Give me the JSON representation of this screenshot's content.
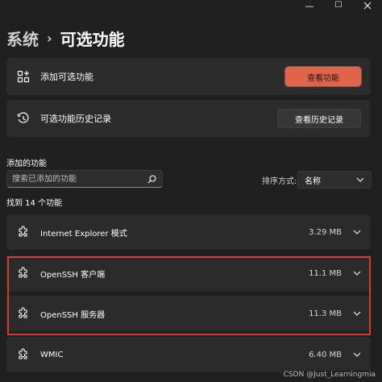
{
  "window": {
    "controls": {
      "minimize_glyph": "—",
      "maximize_glyph": "☐"
    }
  },
  "breadcrumb": {
    "parent": "系统",
    "separator": "›",
    "current": "可选功能"
  },
  "actions": [
    {
      "icon": "add-feature-icon",
      "label": "添加可选功能",
      "button_label": "查看功能",
      "button_style": "accent"
    },
    {
      "icon": "history-icon",
      "label": "可选功能历史记录",
      "button_label": "查看历史记录",
      "button_style": "neutral"
    }
  ],
  "installed": {
    "section_title": "添加的功能",
    "search": {
      "placeholder": "搜索已添加的功能",
      "value": ""
    },
    "sort": {
      "label": "排序方式:",
      "value": "名称"
    },
    "found_count": "找到 14 个功能",
    "features": [
      {
        "icon": "puzzle-icon",
        "name": "Internet Explorer 模式",
        "size": "3.29 MB"
      },
      {
        "icon": "puzzle-icon",
        "name": "OpenSSH 客户端",
        "size": "11.1 MB"
      },
      {
        "icon": "puzzle-icon",
        "name": "OpenSSH 服务器",
        "size": "11.3 MB"
      },
      {
        "icon": "puzzle-icon",
        "name": "WMIC",
        "size": "6.40 MB"
      }
    ]
  },
  "colors": {
    "accent": "#e0634a",
    "highlight": "#d73b32",
    "background": "#202020",
    "card": "#2b2b2b"
  },
  "watermark": "CSDN @Just_Learningmia"
}
